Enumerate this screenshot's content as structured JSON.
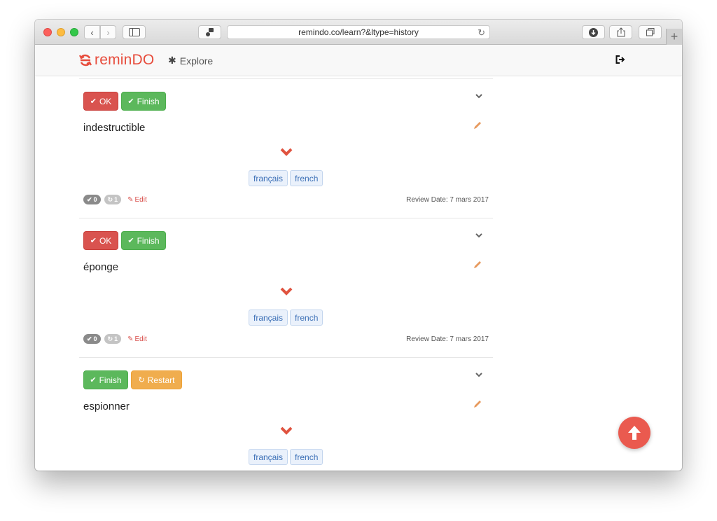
{
  "browser": {
    "url": "remindo.co/learn?&ltype=history",
    "back_glyph": "‹",
    "forward_glyph": "›",
    "newtab_glyph": "+"
  },
  "site": {
    "logo_text": "reminDO",
    "explore_label": "Explore",
    "accent_color": "#e74c3c"
  },
  "cards": [
    {
      "word": "indestructible",
      "buttons": [
        {
          "label": "OK",
          "icon": "check-icon"
        },
        {
          "label": "Finish",
          "icon": "check-circle-icon"
        }
      ],
      "tags": [
        "français",
        "french"
      ],
      "correct_count": "0",
      "repeat_count": "1",
      "edit_label": "Edit",
      "review_date": "Review Date: 7 mars 2017"
    },
    {
      "word": "éponge",
      "buttons": [
        {
          "label": "OK",
          "icon": "check-icon"
        },
        {
          "label": "Finish",
          "icon": "check-circle-icon"
        }
      ],
      "tags": [
        "français",
        "french"
      ],
      "correct_count": "0",
      "repeat_count": "1",
      "edit_label": "Edit",
      "review_date": "Review Date: 7 mars 2017"
    },
    {
      "word": "espionner",
      "buttons": [
        {
          "label": "Finish",
          "icon": "check-circle-icon"
        },
        {
          "label": "Restart",
          "icon": "refresh-icon"
        }
      ],
      "tags": [
        "français",
        "french"
      ]
    }
  ]
}
